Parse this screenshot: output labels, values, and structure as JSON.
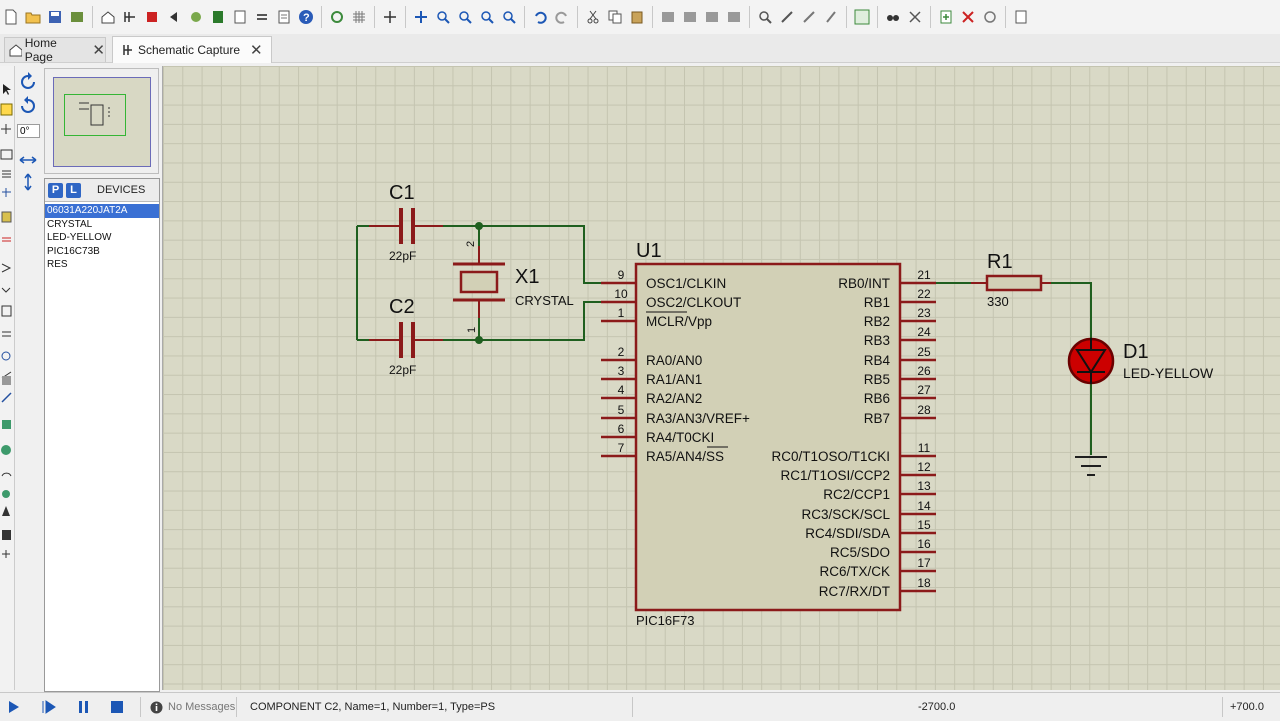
{
  "tabs": [
    {
      "label": "Home Page",
      "icon": "home-icon"
    },
    {
      "label": "Schematic Capture",
      "icon": "schematic-icon"
    }
  ],
  "editor": {
    "rotation_value": "0°"
  },
  "devices": {
    "header": "DEVICES",
    "pick_label": "P",
    "library_label": "L",
    "items": [
      "06031A220JAT2A",
      "CRYSTAL",
      "LED-YELLOW",
      "PIC16C73B",
      "RES"
    ],
    "selected_index": 0
  },
  "schematic": {
    "c1": {
      "ref": "C1",
      "value": "22pF"
    },
    "c2": {
      "ref": "C2",
      "value": "22pF"
    },
    "x1": {
      "ref": "X1",
      "value": "CRYSTAL",
      "pin_top": "2",
      "pin_bottom": "1"
    },
    "u1": {
      "ref": "U1",
      "part": "PIC16F73"
    },
    "r1": {
      "ref": "R1",
      "value": "330"
    },
    "d1": {
      "ref": "D1",
      "value": "LED-YELLOW"
    },
    "u1_left_pins": [
      {
        "num": "9",
        "name": "OSC1/CLKIN"
      },
      {
        "num": "10",
        "name": "OSC2/CLKOUT"
      },
      {
        "num": "1",
        "name": "MCLR/Vpp"
      },
      {
        "num": "2",
        "name": "RA0/AN0"
      },
      {
        "num": "3",
        "name": "RA1/AN1"
      },
      {
        "num": "4",
        "name": "RA2/AN2"
      },
      {
        "num": "5",
        "name": "RA3/AN3/VREF+"
      },
      {
        "num": "6",
        "name": "RA4/T0CKI"
      },
      {
        "num": "7",
        "name": "RA5/AN4/SS"
      }
    ],
    "u1_right_pins": [
      {
        "num": "21",
        "name": "RB0/INT"
      },
      {
        "num": "22",
        "name": "RB1"
      },
      {
        "num": "23",
        "name": "RB2"
      },
      {
        "num": "24",
        "name": "RB3"
      },
      {
        "num": "25",
        "name": "RB4"
      },
      {
        "num": "26",
        "name": "RB5"
      },
      {
        "num": "27",
        "name": "RB6"
      },
      {
        "num": "28",
        "name": "RB7"
      },
      {
        "num": "11",
        "name": "RC0/T1OSO/T1CKI"
      },
      {
        "num": "12",
        "name": "RC1/T1OSI/CCP2"
      },
      {
        "num": "13",
        "name": "RC2/CCP1"
      },
      {
        "num": "14",
        "name": "RC3/SCK/SCL"
      },
      {
        "num": "15",
        "name": "RC4/SDI/SDA"
      },
      {
        "num": "16",
        "name": "RC5/SDO"
      },
      {
        "num": "17",
        "name": "RC6/TX/CK"
      },
      {
        "num": "18",
        "name": "RC7/RX/DT"
      }
    ]
  },
  "status": {
    "messages": "No Messages",
    "info": "COMPONENT C2, Name=1, Number=1, Type=PS",
    "coord_x": "-2700.0",
    "coord_y": "+700.0"
  },
  "colors": {
    "wire": "#1f5f1f",
    "component": "#8b1a1a",
    "component_fill": "#d2d0b6",
    "grid_bg": "#d9d9c6",
    "selection": "#3a70d4"
  }
}
